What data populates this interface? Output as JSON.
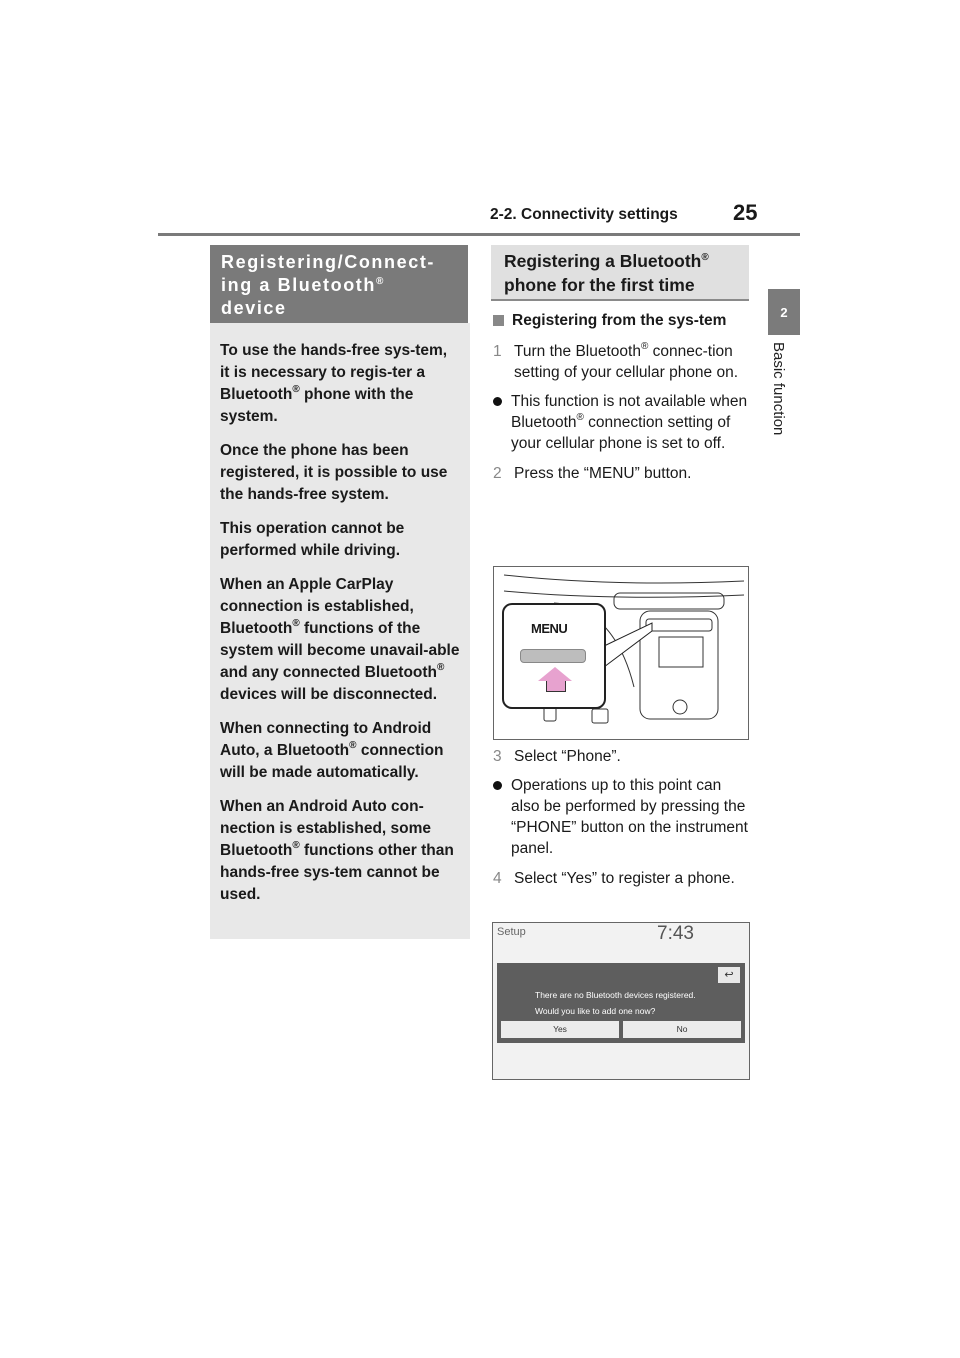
{
  "header": {
    "section": "2-2. Connectivity settings",
    "page_number": "25"
  },
  "side_tab": {
    "chapter_number": "2",
    "chapter_label": "Basic function"
  },
  "left_box": {
    "title_line1": "Registering/Connect-",
    "title_line2": "ing a Bluetooth",
    "title_line3": "device",
    "reg": "®",
    "paragraphs": [
      {
        "pre": "To use the hands-free sys-tem, it is necessary to regis-ter a Bluetooth",
        "post": " phone with the system."
      },
      {
        "pre": "Once the phone has been registered, it is possible to use the hands-free system.",
        "post": ""
      },
      {
        "pre": "This operation cannot be performed while driving.",
        "post": ""
      },
      {
        "pre": "When an Apple CarPlay connection is established, Bluetooth",
        "mid": " functions of the system will become unavail-able and any connected Bluetooth",
        "post": " devices will be disconnected."
      },
      {
        "pre": "When connecting to Android Auto, a Bluetooth",
        "post": " connection will be made automatically."
      },
      {
        "pre": "When an Android Auto con-nection is established, some Bluetooth",
        "post": " functions other than hands-free sys-tem cannot be used."
      }
    ]
  },
  "right_box": {
    "title_line1": "Registering a Bluetooth",
    "title_line2": "phone for the first time",
    "subheading": "Registering from the sys-tem",
    "steps": [
      {
        "num": "1",
        "pre": "Turn the Bluetooth",
        "post": " connec-tion setting of your cellular phone on."
      },
      {
        "num": "2",
        "pre": "Press the “MENU” button.",
        "post": ""
      },
      {
        "num": "3",
        "pre": "Select “Phone”.",
        "post": ""
      },
      {
        "num": "4",
        "pre": "Select “Yes” to register a phone.",
        "post": ""
      }
    ],
    "bullets": [
      {
        "pre": "This function is not available when Bluetooth",
        "post": " connection setting of your cellular phone is set to off."
      },
      {
        "pre": "Operations up to this point can also be performed by pressing the “PHONE” button on the instrument panel.",
        "post": ""
      }
    ]
  },
  "illustration_menu": {
    "label": "MENU",
    "arrow_color": "#e7a2cf"
  },
  "illustration_screen": {
    "title": "Setup",
    "time": "7:43",
    "back_icon": "↩",
    "message_line1": "There are no Bluetooth devices registered.",
    "message_line2": "Would you like to add one now?",
    "yes_label": "Yes",
    "no_label": "No"
  }
}
